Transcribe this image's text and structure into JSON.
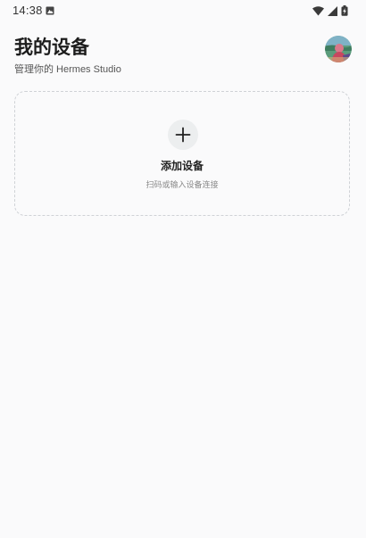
{
  "status_bar": {
    "time": "14:38",
    "notification_icon": "photo-icon",
    "icons": [
      "wifi-icon",
      "cellular-signal-icon",
      "battery-charging-icon"
    ]
  },
  "header": {
    "title": "我的设备",
    "subtitle": "管理你的 Hermes Studio",
    "avatar_icon": "avatar"
  },
  "add_device": {
    "icon": "plus-icon",
    "label": "添加设备",
    "description": "扫码或输入设备连接"
  },
  "colors": {
    "background": "#fafafb",
    "card_border": "#cfd2d6",
    "add_circle": "#eceeef",
    "title_text": "#1c1c1c"
  }
}
